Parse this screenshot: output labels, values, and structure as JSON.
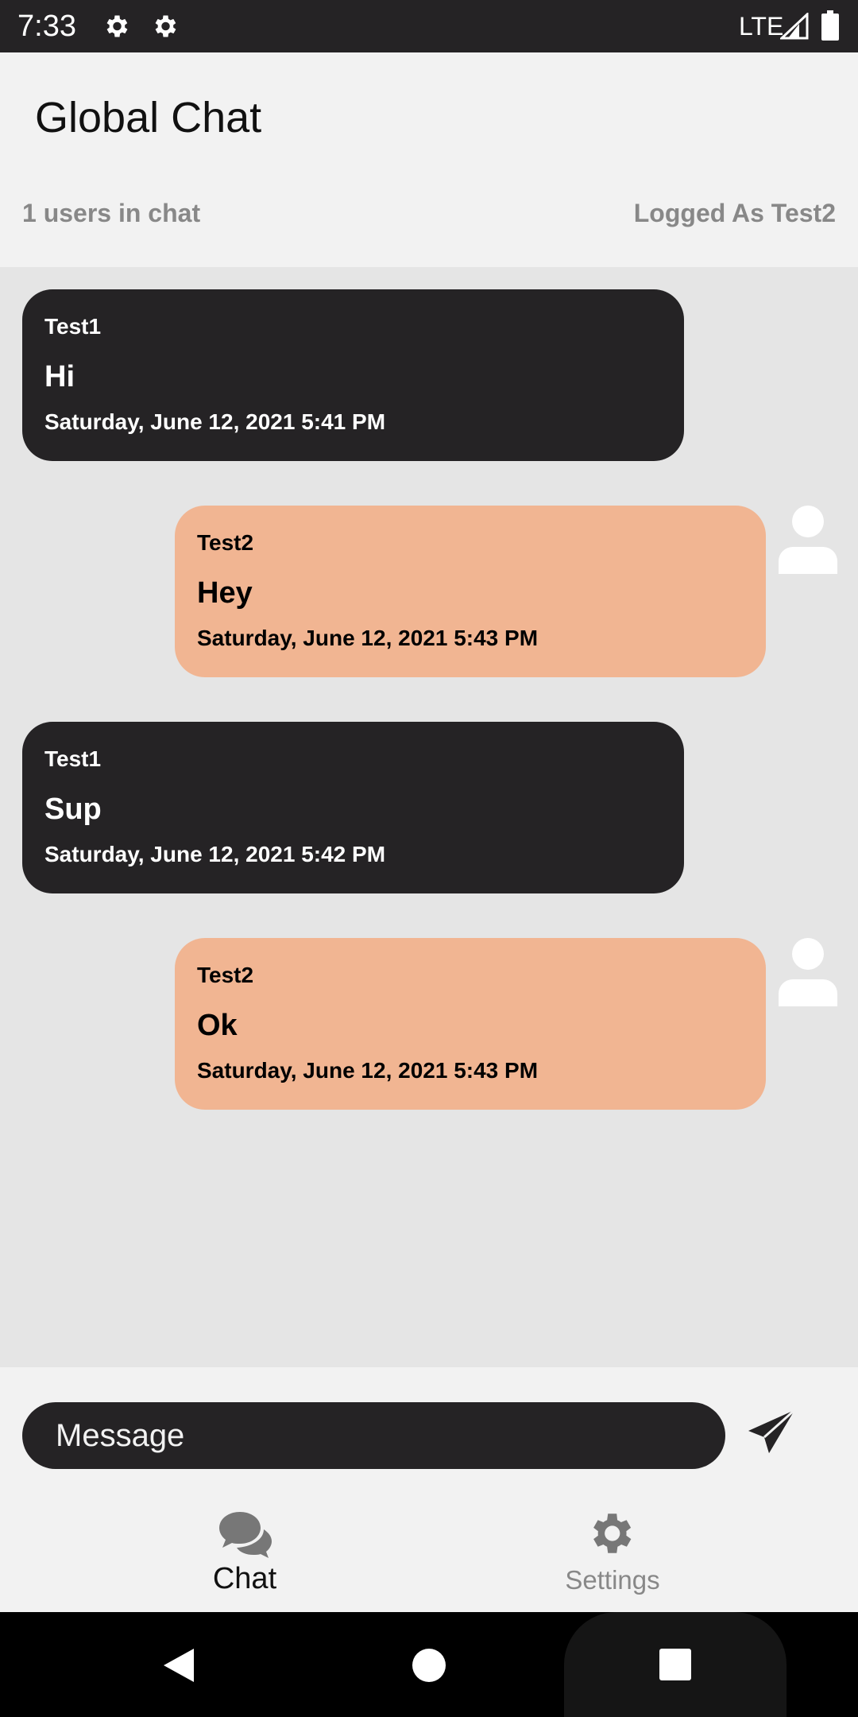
{
  "status_bar": {
    "time": "7:33",
    "network": "LTE",
    "icons": [
      "gear-icon",
      "gear-icon",
      "signal-icon",
      "battery-icon"
    ]
  },
  "header": {
    "title": "Global Chat",
    "users_count": "1 users in chat",
    "logged_as": "Logged As Test2"
  },
  "messages": [
    {
      "sender": "Test1",
      "text": "Hi",
      "time": "Saturday, June 12, 2021 5:41 PM",
      "direction": "received"
    },
    {
      "sender": "Test2",
      "text": "Hey",
      "time": "Saturday, June 12, 2021 5:43 PM",
      "direction": "sent"
    },
    {
      "sender": "Test1",
      "text": "Sup",
      "time": "Saturday, June 12, 2021 5:42 PM",
      "direction": "received"
    },
    {
      "sender": "Test2",
      "text": "Ok",
      "time": "Saturday, June 12, 2021 5:43 PM",
      "direction": "sent"
    }
  ],
  "composer": {
    "placeholder": "Message",
    "send_icon": "send-icon"
  },
  "bottom_nav": {
    "items": [
      {
        "label": "Chat",
        "icon": "chat-bubbles-icon",
        "active": true
      },
      {
        "label": "Settings",
        "icon": "gear-icon",
        "active": false
      }
    ]
  },
  "colors": {
    "received_bubble": "#252325",
    "sent_bubble": "#f1b592",
    "chat_background": "#e5e5e5",
    "header_background": "#f2f2f2",
    "muted_text": "#888888"
  }
}
